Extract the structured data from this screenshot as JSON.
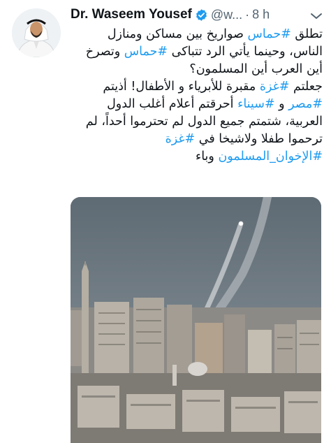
{
  "author": {
    "display_name": "Dr. Waseem Yousef",
    "handle": "@w...",
    "separator": "·",
    "timestamp": "8 h",
    "verified": true,
    "accent_color": "#1d9bf0"
  },
  "tweet": {
    "paragraph1": [
      {
        "text": "تطلق ",
        "tag": false
      },
      {
        "text": "#حماس",
        "tag": true
      },
      {
        "text": " صواريخ بين مساكن ومنازل الناس، وحينما يأتي الرد تتباكى ",
        "tag": false
      },
      {
        "text": "#حماس",
        "tag": true
      },
      {
        "text": " وتصرخ أين العرب أين المسلمون؟",
        "tag": false
      }
    ],
    "paragraph2": [
      {
        "text": "جعلتم ",
        "tag": false
      },
      {
        "text": "#غزة",
        "tag": true
      },
      {
        "text": " مقبرة للأبرياء و الأطفال! أذيتم ",
        "tag": false
      },
      {
        "text": "#مصر",
        "tag": true
      },
      {
        "text": " و ",
        "tag": false
      },
      {
        "text": "#سيناء",
        "tag": true
      },
      {
        "text": " أحرقتم أعلام أغلب الدول العربية، شتمتم جميع الدول لم تحترموا أحداً، لم ترحموا طفلا ولاشيخا في ",
        "tag": false
      },
      {
        "text": "#غزة",
        "tag": true
      },
      {
        "text": " ",
        "tag": false
      },
      {
        "text": "#الإخوان_المسلمون",
        "tag": true
      },
      {
        "text": " وباء",
        "tag": false
      }
    ]
  },
  "icons": {
    "verified": "verified-badge-icon",
    "more": "chevron-down-icon"
  }
}
